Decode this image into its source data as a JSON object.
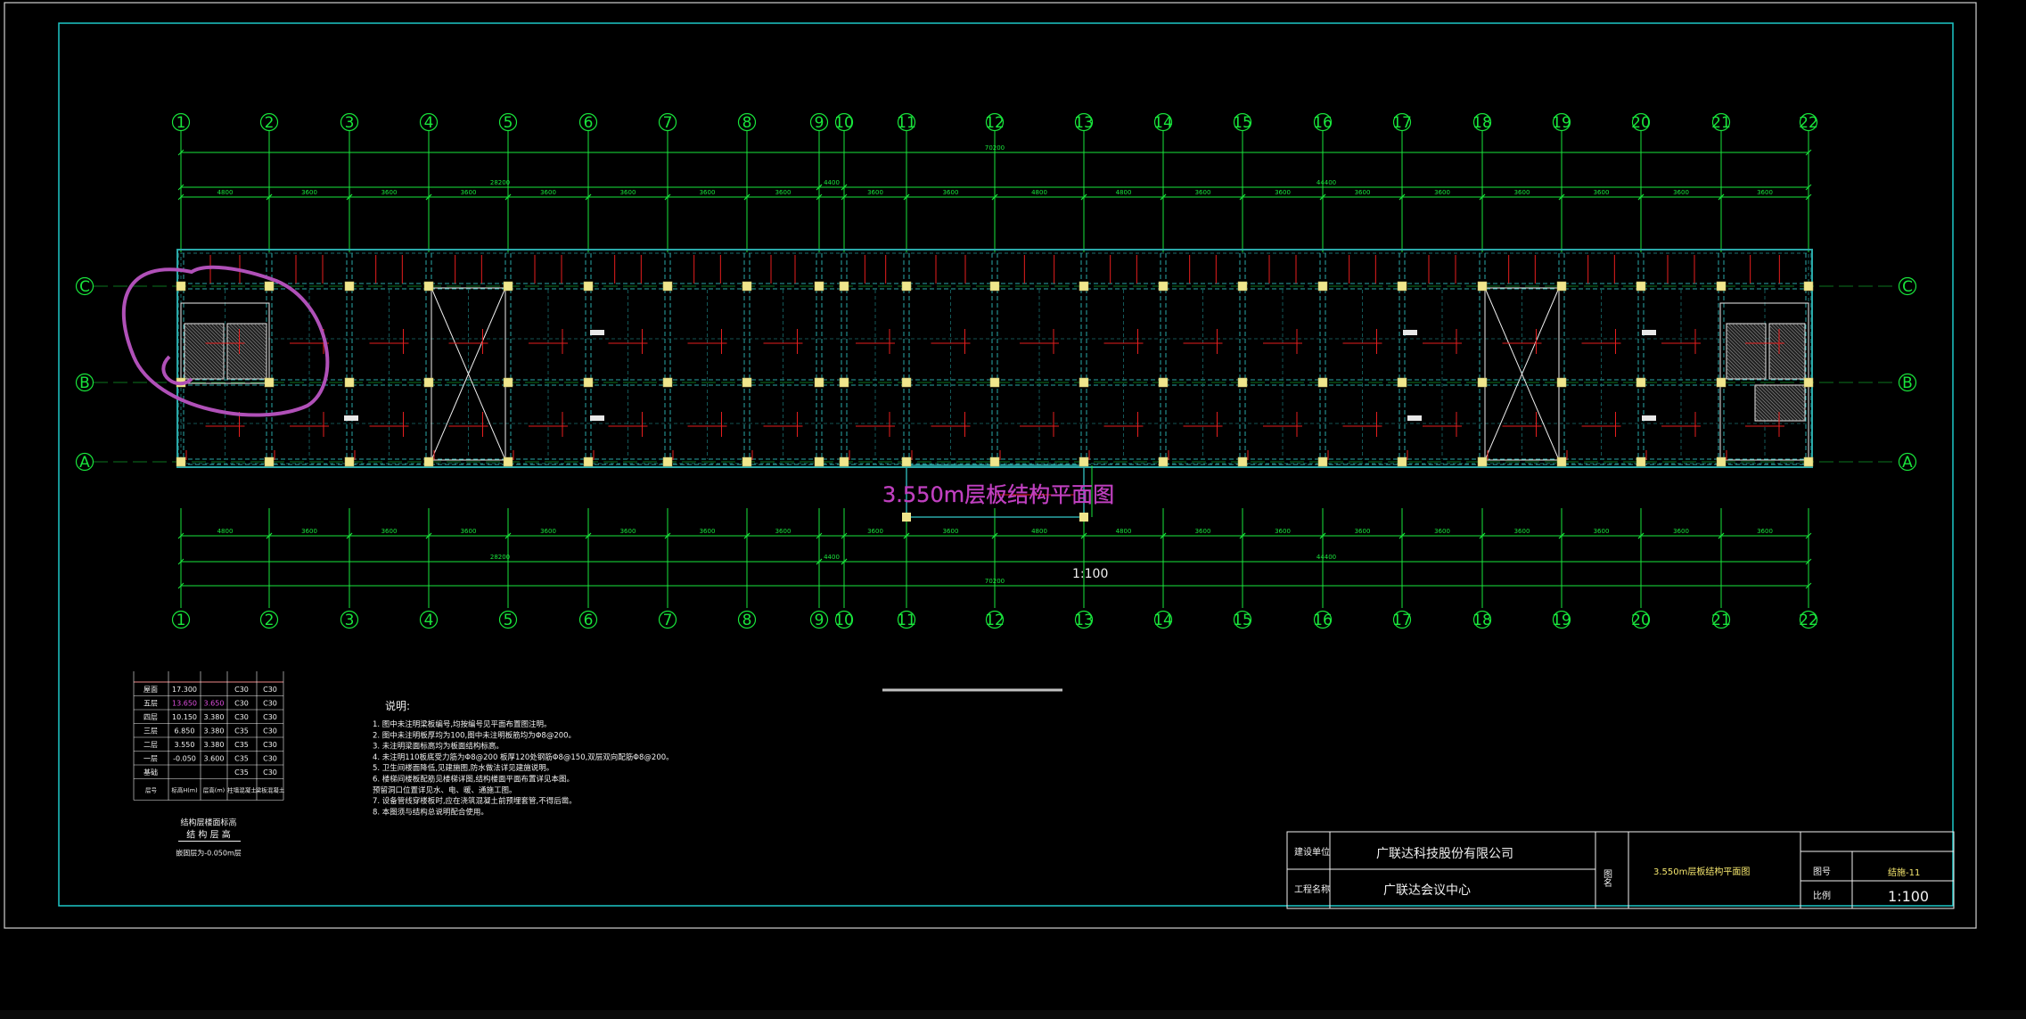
{
  "drawing": {
    "title": "3.550m层板结构平面图",
    "scale_label": "1:100"
  },
  "grid": {
    "columns": [
      "1",
      "2",
      "3",
      "4",
      "5",
      "6",
      "7",
      "8",
      "9",
      "10",
      "11",
      "12",
      "13",
      "14",
      "15",
      "16",
      "17",
      "18",
      "19",
      "20",
      "21",
      "22"
    ],
    "rows": [
      "C",
      "B",
      "A"
    ]
  },
  "dimensions": {
    "top_total": "70200",
    "top_sub": [
      "28200",
      "4400",
      "44400"
    ],
    "bays": [
      "4800",
      "3600",
      "3600",
      "3600",
      "3600",
      "3600",
      "3600",
      "3600",
      "3600",
      "3600",
      "4800",
      "4800",
      "3600",
      "3600",
      "3600",
      "3600",
      "3600",
      "3600",
      "3600",
      "3600"
    ]
  },
  "floor_table": {
    "rows": [
      {
        "floor": "屋面",
        "elev": "17.300",
        "height": "",
        "conc_col": "C30",
        "conc_beam": "C30"
      },
      {
        "floor": "五层",
        "elev": "13.650",
        "height": "3.650",
        "conc_col": "C30",
        "conc_beam": "C30"
      },
      {
        "floor": "四层",
        "elev": "10.150",
        "height": "3.380",
        "conc_col": "C30",
        "conc_beam": "C30"
      },
      {
        "floor": "三层",
        "elev": "6.850",
        "height": "3.380",
        "conc_col": "C35",
        "conc_beam": "C30"
      },
      {
        "floor": "二层",
        "elev": "3.550",
        "height": "3.380",
        "conc_col": "C35",
        "conc_beam": "C30"
      },
      {
        "floor": "一层",
        "elev": "-0.050",
        "height": "3.600",
        "conc_col": "C35",
        "conc_beam": "C30"
      },
      {
        "floor": "基础",
        "elev": "",
        "height": "",
        "conc_col": "C35",
        "conc_beam": "C30"
      }
    ],
    "headers": [
      "层号",
      "标高H(m)",
      "层高(m)",
      "柱墙混凝土",
      "梁板混凝土"
    ],
    "caption1": "结构层楼面标高",
    "caption2": "结 构 层 高",
    "caption3": "嵌固层为-0.050m层"
  },
  "notes": {
    "heading": "说明:",
    "lines": [
      "1. 图中未注明梁板编号,均按编号见平面布置图注明。",
      "2. 图中未注明板厚均为100,图中未注明板筋均为Φ8@200。",
      "3. 未注明梁面标高均为板面结构标高。",
      "4. 未注明110板底受力筋为Φ8@200          板厚120处钢筋Φ8@150,双层双向配筋Φ8@200。",
      "5. 卫生间楼面降低,见建施图,防水做法详见建施说明。",
      "6. 楼梯间楼板配筋见楼梯详图,结构楼面平面布置详见本图。",
      "   预留洞口位置详见水、电、暖、通施工图。",
      "7. 设备管线穿楼板时,应在浇筑混凝土前预埋套管,不得后凿。",
      "8. 本图须与结构总说明配合使用。"
    ]
  },
  "title_block": {
    "label_unit": "建设单位",
    "unit_value": "广联达科技股份有限公司",
    "label_project": "工程名称",
    "project_value": "广联达会议中心",
    "label_drawing": "图名",
    "drawing_value": "3.550m层板结构平面图",
    "label_no": "图号",
    "no_value": "结施-11",
    "label_scale": "比例",
    "scale_value": "1:100"
  },
  "colors": {
    "background": "#000000",
    "grid_green": "#19e63c",
    "border_cyan": "#1ec8c8",
    "beam_cyan": "#2aa8a8",
    "rebar_red": "#e61e1e",
    "column_yellow": "#f0e68c",
    "annotation_magenta": "#c040c0"
  }
}
